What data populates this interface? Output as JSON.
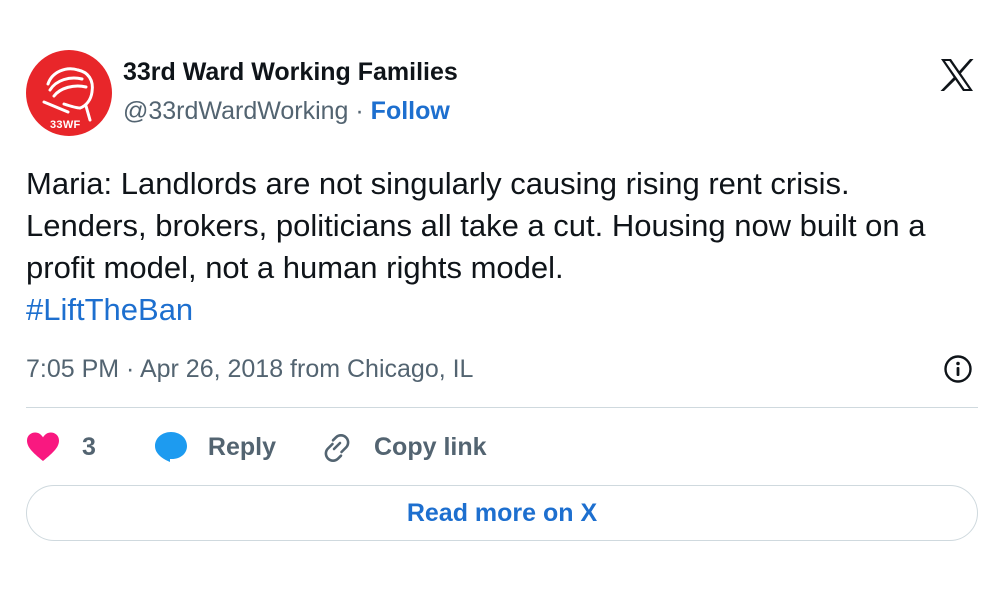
{
  "author": {
    "name": "33rd Ward Working Families",
    "handle": "@33rdWardWorking",
    "separator": " · ",
    "follow_label": "Follow",
    "avatar_badge": "33WF"
  },
  "tweet": {
    "text": "Maria: Landlords are not singularly causing rising rent crisis. Lenders, brokers, politicians all take a cut. Housing now built on a profit model, not a human rights model.",
    "hashtag": "#LiftTheBan",
    "timestamp": "7:05 PM · Apr 26, 2018 from Chicago, IL"
  },
  "actions": {
    "like_count": "3",
    "reply_label": "Reply",
    "copy_link_label": "Copy link"
  },
  "read_more_label": "Read more on X",
  "colors": {
    "link": "#1d6fcf",
    "heart": "#f91880",
    "reply_bubble": "#1d9bf0",
    "avatar_bg": "#e8262a",
    "muted_text": "#536471",
    "border": "#cfd9de"
  },
  "icons": [
    "fist-logo-icon",
    "x-logo-icon",
    "info-icon",
    "heart-icon",
    "reply-icon",
    "link-icon"
  ]
}
